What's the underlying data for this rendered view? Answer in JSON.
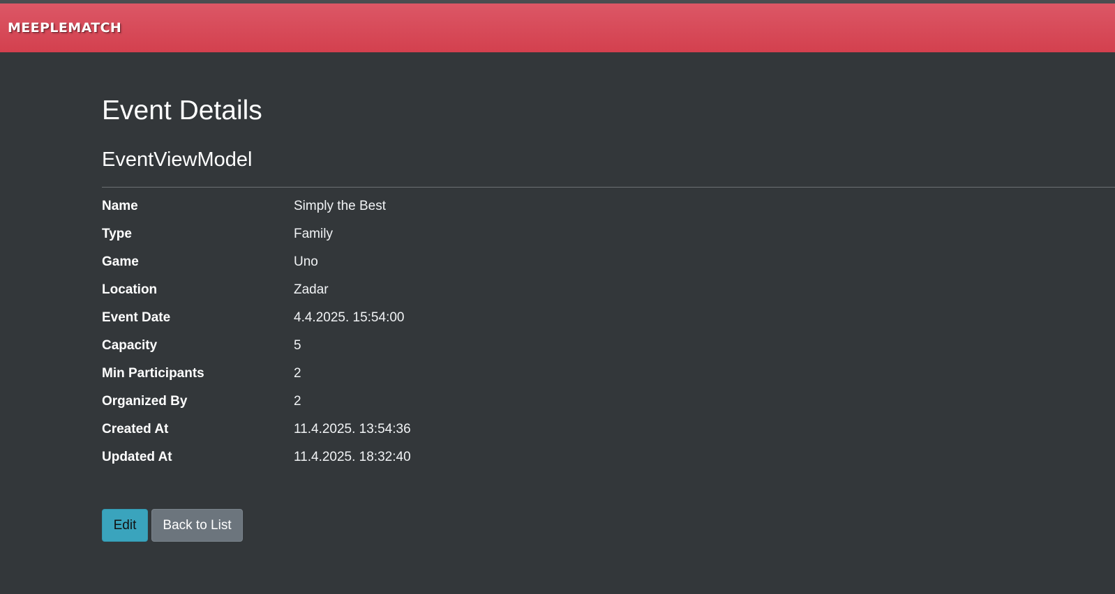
{
  "navbar": {
    "brand": "MEEPLEMATCH"
  },
  "page": {
    "title": "Event Details",
    "subtitle": "EventViewModel"
  },
  "details": [
    {
      "label": "Name",
      "value": "Simply the Best"
    },
    {
      "label": "Type",
      "value": "Family"
    },
    {
      "label": "Game",
      "value": "Uno"
    },
    {
      "label": "Location",
      "value": "Zadar"
    },
    {
      "label": "Event Date",
      "value": "4.4.2025. 15:54:00"
    },
    {
      "label": "Capacity",
      "value": "5"
    },
    {
      "label": "Min Participants",
      "value": "2"
    },
    {
      "label": "Organized By",
      "value": "2"
    },
    {
      "label": "Created At",
      "value": "11.4.2025. 13:54:36"
    },
    {
      "label": "Updated At",
      "value": "11.4.2025. 18:32:40"
    }
  ],
  "actions": {
    "edit_label": "Edit",
    "back_label": "Back to List"
  },
  "colors": {
    "navbar": "#d84b5a",
    "background": "#33373a",
    "edit_button": "#3aa4bd",
    "back_button": "#6c757d"
  }
}
